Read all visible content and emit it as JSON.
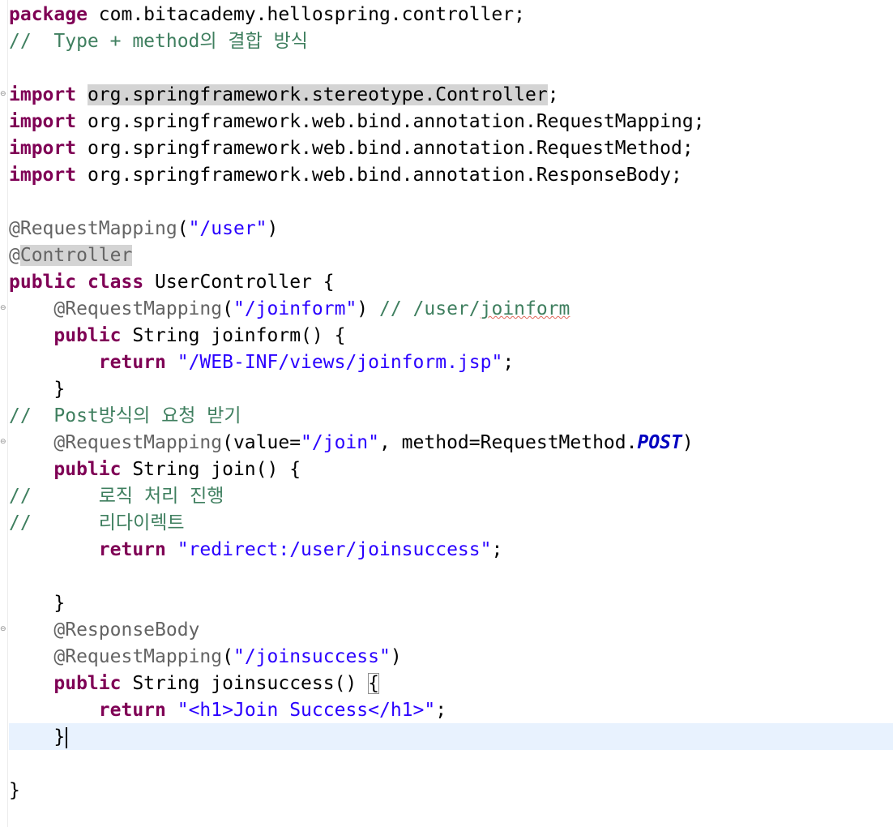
{
  "editor": {
    "lines": [
      [
        {
          "t": "package",
          "c": "kw"
        },
        {
          "t": " com.bitacademy.hellospring.controller;",
          "c": ""
        }
      ],
      [
        {
          "t": "//  Type + method의 결합 방식",
          "c": "cmt"
        }
      ],
      [],
      [
        {
          "t": "import",
          "c": "kw"
        },
        {
          "t": " ",
          "c": ""
        },
        {
          "t": "org.springframework.stereotype.Controller",
          "c": "occ"
        },
        {
          "t": ";",
          "c": ""
        }
      ],
      [
        {
          "t": "import",
          "c": "kw"
        },
        {
          "t": " org.springframework.web.bind.annotation.RequestMapping;",
          "c": ""
        }
      ],
      [
        {
          "t": "import",
          "c": "kw"
        },
        {
          "t": " org.springframework.web.bind.annotation.RequestMethod;",
          "c": ""
        }
      ],
      [
        {
          "t": "import",
          "c": "kw"
        },
        {
          "t": " org.springframework.web.bind.annotation.ResponseBody;",
          "c": ""
        }
      ],
      [],
      [
        {
          "t": "@RequestMapping",
          "c": "ann"
        },
        {
          "t": "(",
          "c": ""
        },
        {
          "t": "\"/user\"",
          "c": "str"
        },
        {
          "t": ")",
          "c": ""
        }
      ],
      [
        {
          "t": "@",
          "c": "ann"
        },
        {
          "t": "Controller",
          "c": "ann occ"
        }
      ],
      [
        {
          "t": "public",
          "c": "kw"
        },
        {
          "t": " ",
          "c": ""
        },
        {
          "t": "class",
          "c": "kw"
        },
        {
          "t": " UserController {",
          "c": ""
        }
      ],
      [
        {
          "t": "    ",
          "c": ""
        },
        {
          "t": "@RequestMapping",
          "c": "ann"
        },
        {
          "t": "(",
          "c": ""
        },
        {
          "t": "\"/joinform\"",
          "c": "str"
        },
        {
          "t": ") ",
          "c": ""
        },
        {
          "t": "// /user/",
          "c": "cmt"
        },
        {
          "t": "joinform",
          "c": "cmt squig"
        }
      ],
      [
        {
          "t": "    ",
          "c": ""
        },
        {
          "t": "public",
          "c": "kw"
        },
        {
          "t": " String joinform() {",
          "c": ""
        }
      ],
      [
        {
          "t": "        ",
          "c": ""
        },
        {
          "t": "return",
          "c": "kw"
        },
        {
          "t": " ",
          "c": ""
        },
        {
          "t": "\"/WEB-INF/views/joinform.jsp\"",
          "c": "str"
        },
        {
          "t": ";",
          "c": ""
        }
      ],
      [
        {
          "t": "    }",
          "c": ""
        }
      ],
      [
        {
          "t": "//  Post방식의 요청 받기",
          "c": "cmt"
        }
      ],
      [
        {
          "t": "    ",
          "c": ""
        },
        {
          "t": "@RequestMapping",
          "c": "ann"
        },
        {
          "t": "(value=",
          "c": ""
        },
        {
          "t": "\"/join\"",
          "c": "str"
        },
        {
          "t": ", method=RequestMethod.",
          "c": ""
        },
        {
          "t": "POST",
          "c": "const"
        },
        {
          "t": ")",
          "c": ""
        }
      ],
      [
        {
          "t": "    ",
          "c": ""
        },
        {
          "t": "public",
          "c": "kw"
        },
        {
          "t": " String join() {",
          "c": ""
        }
      ],
      [
        {
          "t": "//      로직 처리 진행",
          "c": "cmt"
        }
      ],
      [
        {
          "t": "//      리다이렉트",
          "c": "cmt"
        }
      ],
      [
        {
          "t": "        ",
          "c": ""
        },
        {
          "t": "return",
          "c": "kw"
        },
        {
          "t": " ",
          "c": ""
        },
        {
          "t": "\"redirect:/user/joinsuccess\"",
          "c": "str"
        },
        {
          "t": ";",
          "c": ""
        }
      ],
      [],
      [
        {
          "t": "    }",
          "c": ""
        }
      ],
      [
        {
          "t": "    ",
          "c": ""
        },
        {
          "t": "@ResponseBody",
          "c": "ann"
        }
      ],
      [
        {
          "t": "    ",
          "c": ""
        },
        {
          "t": "@RequestMapping",
          "c": "ann"
        },
        {
          "t": "(",
          "c": ""
        },
        {
          "t": "\"/joinsuccess\"",
          "c": "str"
        },
        {
          "t": ")",
          "c": ""
        }
      ],
      [
        {
          "t": "    ",
          "c": ""
        },
        {
          "t": "public",
          "c": "kw"
        },
        {
          "t": " String joinsuccess() ",
          "c": ""
        },
        {
          "t": "{",
          "c": "bracket-box"
        }
      ],
      [
        {
          "t": "        ",
          "c": ""
        },
        {
          "t": "return",
          "c": "kw"
        },
        {
          "t": " ",
          "c": ""
        },
        {
          "t": "\"<h1>Join Success</h1>\"",
          "c": "str"
        },
        {
          "t": ";",
          "c": ""
        }
      ],
      [
        {
          "t": "    }",
          "c": "",
          "caret": true
        }
      ],
      [],
      [
        {
          "t": "}",
          "c": ""
        }
      ]
    ],
    "fold_markers": [
      3,
      11,
      16,
      23
    ],
    "current_line": 27
  }
}
